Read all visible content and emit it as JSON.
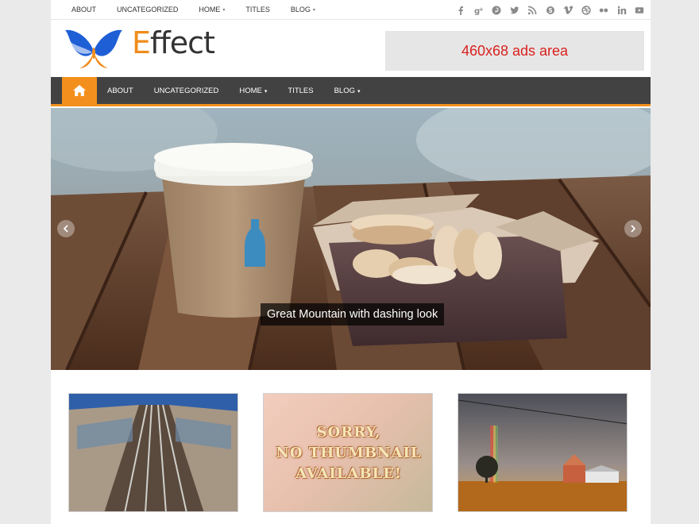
{
  "top_nav": {
    "items": [
      {
        "label": "ABOUT",
        "has_dropdown": false
      },
      {
        "label": "UNCATEGORIZED",
        "has_dropdown": false
      },
      {
        "label": "HOME",
        "has_dropdown": true
      },
      {
        "label": "TITLES",
        "has_dropdown": false
      },
      {
        "label": "BLOG",
        "has_dropdown": true
      }
    ],
    "caret": "▾"
  },
  "social_icons": [
    "facebook-icon",
    "google-plus-icon",
    "pinterest-icon",
    "twitter-icon",
    "rss-icon",
    "skype-icon",
    "vimeo-icon",
    "dribbble-icon",
    "flickr-icon",
    "linkedin-icon",
    "youtube-icon"
  ],
  "header": {
    "logo_first": "E",
    "logo_rest": "ffect",
    "ad_text": "460x68 ads area"
  },
  "main_nav": {
    "items": [
      {
        "label": "ABOUT",
        "has_dropdown": false
      },
      {
        "label": "UNCATEGORIZED",
        "has_dropdown": false
      },
      {
        "label": "HOME",
        "has_dropdown": true
      },
      {
        "label": "TITLES",
        "has_dropdown": false
      },
      {
        "label": "BLOG",
        "has_dropdown": true
      }
    ],
    "caret": "▾"
  },
  "slider": {
    "caption": "Great Mountain with dashing look"
  },
  "thumbnails": {
    "placeholder_lines": [
      "SORRY,",
      "NO THUMBNAIL",
      "AVAILABLE!"
    ]
  },
  "colors": {
    "accent": "#f3901d",
    "nav_bg": "#424242",
    "ad_text": "#d9211f"
  }
}
